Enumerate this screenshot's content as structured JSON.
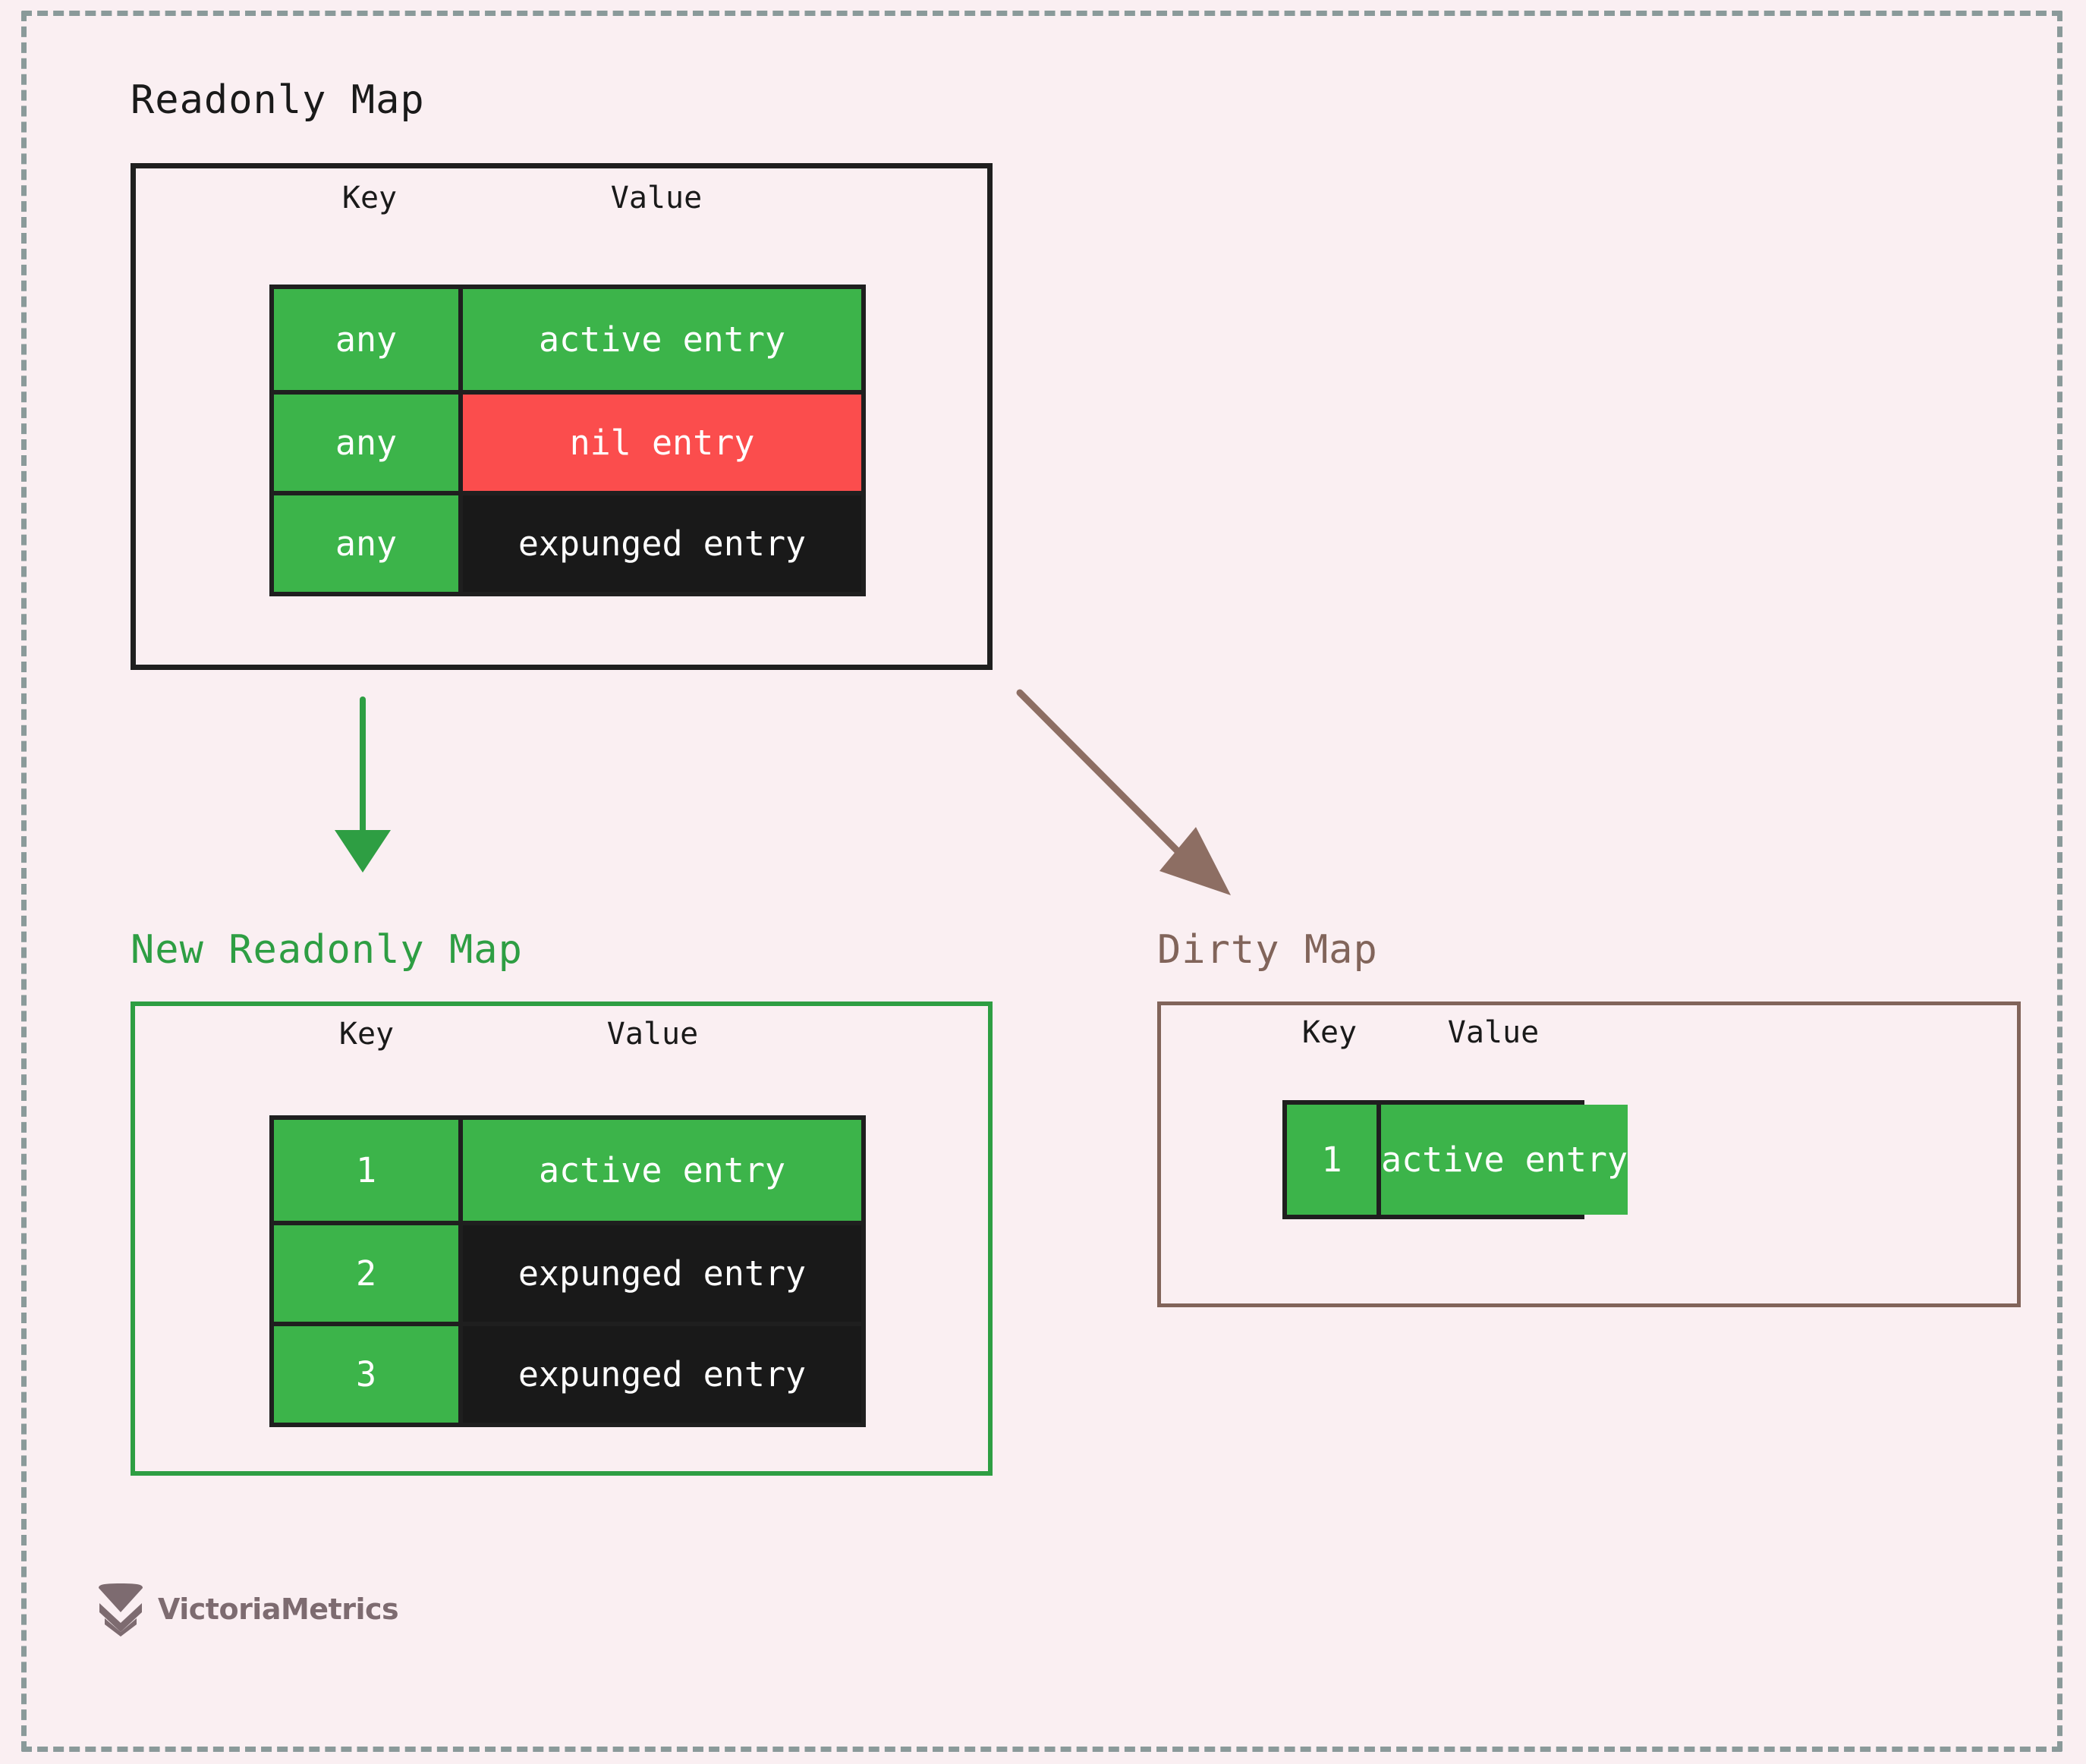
{
  "diagram": {
    "title_readonly": "Readonly Map",
    "title_new_readonly": "New Readonly Map",
    "title_dirty": "Dirty Map",
    "column_headers": {
      "key": "Key",
      "value": "Value"
    }
  },
  "colors": {
    "background": "#faeff2",
    "dashed_frame": "#8a9a9a",
    "active_green": "#3cb44a",
    "nil_red": "#fb4d4d",
    "expunged_black": "#191919",
    "readonly_border": "#1f1f1f",
    "new_readonly_border": "#2e9e43",
    "dirty_border": "#81645a",
    "arrow_green": "#2e9e43",
    "arrow_brown": "#8d6e63",
    "logo_gray": "#7d6b70"
  },
  "readonly_map": {
    "headers": [
      "Key",
      "Value"
    ],
    "rows": [
      {
        "key": "any",
        "value": "active entry",
        "key_fill": "green",
        "value_fill": "green"
      },
      {
        "key": "any",
        "value": "nil entry",
        "key_fill": "green",
        "value_fill": "red"
      },
      {
        "key": "any",
        "value": "expunged entry",
        "key_fill": "green",
        "value_fill": "black"
      }
    ]
  },
  "new_readonly_map": {
    "headers": [
      "Key",
      "Value"
    ],
    "rows": [
      {
        "key": "1",
        "value": "active entry",
        "key_fill": "green",
        "value_fill": "green"
      },
      {
        "key": "2",
        "value": "expunged entry",
        "key_fill": "green",
        "value_fill": "black"
      },
      {
        "key": "3",
        "value": "expunged entry",
        "key_fill": "green",
        "value_fill": "black"
      }
    ]
  },
  "dirty_map": {
    "headers": [
      "Key",
      "Value"
    ],
    "rows": [
      {
        "key": "1",
        "value": "active entry",
        "key_fill": "green",
        "value_fill": "green"
      }
    ]
  },
  "arrows": [
    {
      "name": "readonly-to-new-readonly",
      "color": "#2e9e43",
      "direction": "down"
    },
    {
      "name": "readonly-to-dirty",
      "color": "#8d6e63",
      "direction": "down-right"
    }
  ],
  "branding": {
    "name": "VictoriaMetrics",
    "icon": "victoriametrics-chevron-logo"
  }
}
